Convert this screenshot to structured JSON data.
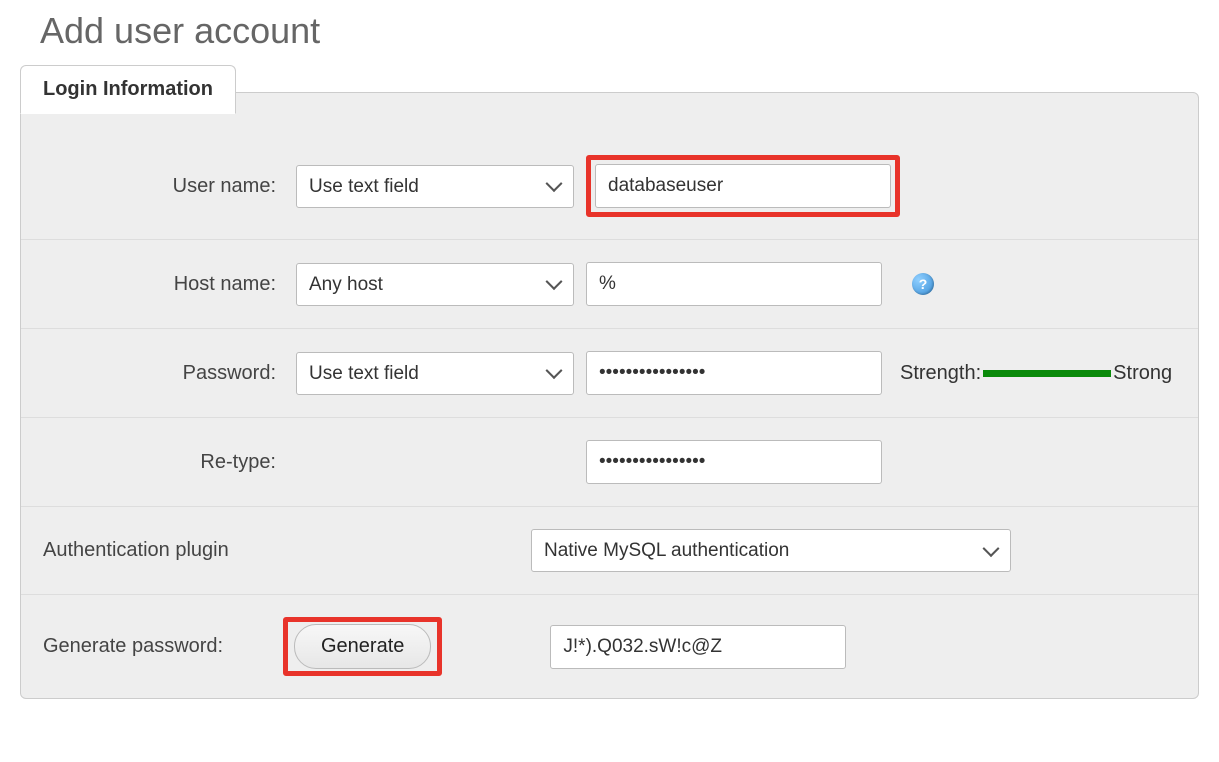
{
  "page": {
    "title": "Add user account"
  },
  "fieldset": {
    "legend": "Login Information"
  },
  "username": {
    "label": "User name:",
    "select_value": "Use text field",
    "value": "databaseuser"
  },
  "hostname": {
    "label": "Host name:",
    "select_value": "Any host",
    "value": "%"
  },
  "password": {
    "label": "Password:",
    "select_value": "Use text field",
    "value": "••••••••••••••••",
    "strength_label": "Strength:",
    "strength_value": "Strong"
  },
  "retype": {
    "label": "Re-type:",
    "value": "••••••••••••••••"
  },
  "auth": {
    "label": "Authentication plugin",
    "select_value": "Native MySQL authentication"
  },
  "generate": {
    "label": "Generate password:",
    "button": "Generate",
    "value": "J!*).Q032.sW!c@Z"
  },
  "icons": {
    "help": "?"
  }
}
